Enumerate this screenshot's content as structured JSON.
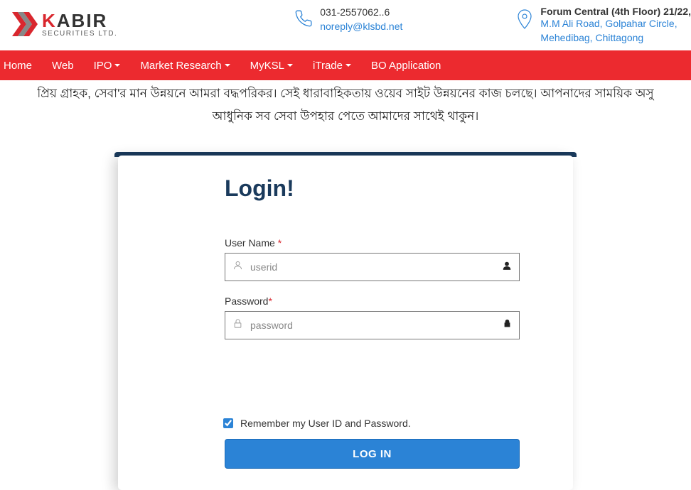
{
  "header": {
    "logo": {
      "main_prefix": "K",
      "main_rest": "ABIR",
      "sub": "SECURITIES LTD."
    },
    "phone": {
      "number": "031-2557062..6",
      "email": "noreply@klsbd.net"
    },
    "address": {
      "title": "Forum Central (4th Floor) 21/22,",
      "line1": "M.M Ali Road, Golpahar Circle,",
      "line2": "Mehedibag, Chittagong"
    }
  },
  "nav": {
    "home": "Home",
    "web": "Web",
    "ipo": "IPO",
    "market_research": "Market Research",
    "myksl": "MyKSL",
    "itrade": "iTrade",
    "bo_application": "BO Application"
  },
  "banner": {
    "line1": "প্রিয় গ্রাহক, সেবা'র মান উন্নয়নে আমরা বদ্ধপরিকর। সেই ধারাবাহিকতায় ওয়েব সাইট উন্নয়নের কাজ চলছে। আপনাদের সাময়িক অসু",
    "line2": "আধুনিক সব সেবা উপহার পেতে আমাদের সাথেই থাকুন।"
  },
  "login": {
    "title": "Login!",
    "username_label": "User Name ",
    "username_placeholder": "userid",
    "password_label": "Password",
    "password_placeholder": "password",
    "remember_label": "Remember my User ID and Password.",
    "submit": "LOG IN",
    "required": "*"
  }
}
